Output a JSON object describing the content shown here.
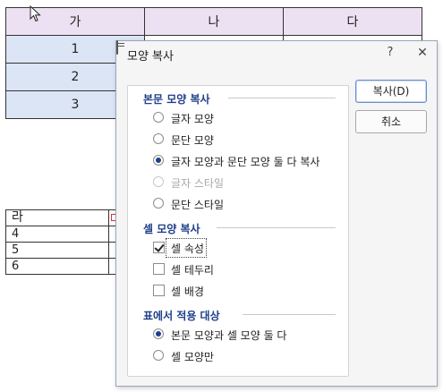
{
  "document": {
    "table1": {
      "headers": [
        "가",
        "나",
        "다"
      ],
      "rows": [
        "1",
        "2",
        "3"
      ]
    },
    "table2": {
      "header": "라",
      "rows": [
        "4",
        "5",
        "6"
      ]
    }
  },
  "dialog": {
    "title": "모양 복사",
    "help_label": "?",
    "close_label": "✕",
    "sections": {
      "body_copy": {
        "title": "본문 모양 복사",
        "options": [
          "글자 모양",
          "문단 모양",
          "글자 모양과 문단 모양 둘 다 복사",
          "글자 스타일",
          "문단 스타일"
        ],
        "selected": "글자 모양과 문단 모양 둘 다 복사"
      },
      "cell_copy": {
        "title": "셀 모양 복사",
        "options": [
          "셀 속성",
          "셀 테두리",
          "셀 배경"
        ],
        "checked": [
          "셀 속성"
        ]
      },
      "table_apply": {
        "title": "표에서 적용 대상",
        "options": [
          "본문 모양과 셀 모양 둘 다",
          "셀 모양만"
        ],
        "selected": "본문 모양과 셀 모양 둘 다"
      }
    },
    "buttons": {
      "copy": "복사(D)",
      "cancel": "취소"
    }
  },
  "colors": {
    "table_header_bg": "#ece1f2",
    "table_num_bg": "#dce5f6",
    "section_title": "#1f3f8a",
    "primary_border": "#6a8ed1"
  }
}
